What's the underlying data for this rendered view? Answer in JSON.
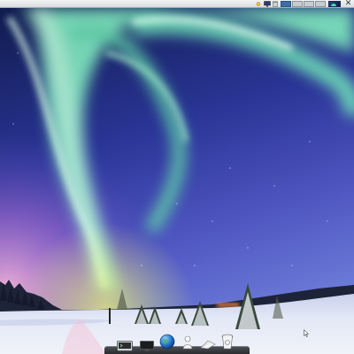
{
  "desktop": {
    "wallpaper": "aurora-borealis-over-snowy-field",
    "colors": {
      "sky_top": "#1a2461",
      "sky_mid": "#3f46a8",
      "aurora": "#8ef0c2",
      "horizon_glow": "#f4a5c9",
      "snow": "#e8ecf6",
      "panel": "#e2e4e7",
      "dock": "#35373b",
      "active_workspace": "#3d6ea8"
    }
  },
  "top_panel": {
    "tray_icons": [
      "weather-icon",
      "monitor-icon",
      "trash-mini-icon"
    ],
    "workspaces": [
      "workspace-1",
      "workspace-2",
      "workspace-3",
      "workspace-4"
    ],
    "active_workspace": 1,
    "close_glyph": "✕"
  },
  "dock": {
    "items": [
      "terminal-icon",
      "monitor-icon",
      "globe-icon",
      "user-icon",
      "mail-icon",
      "trash-icon"
    ]
  }
}
